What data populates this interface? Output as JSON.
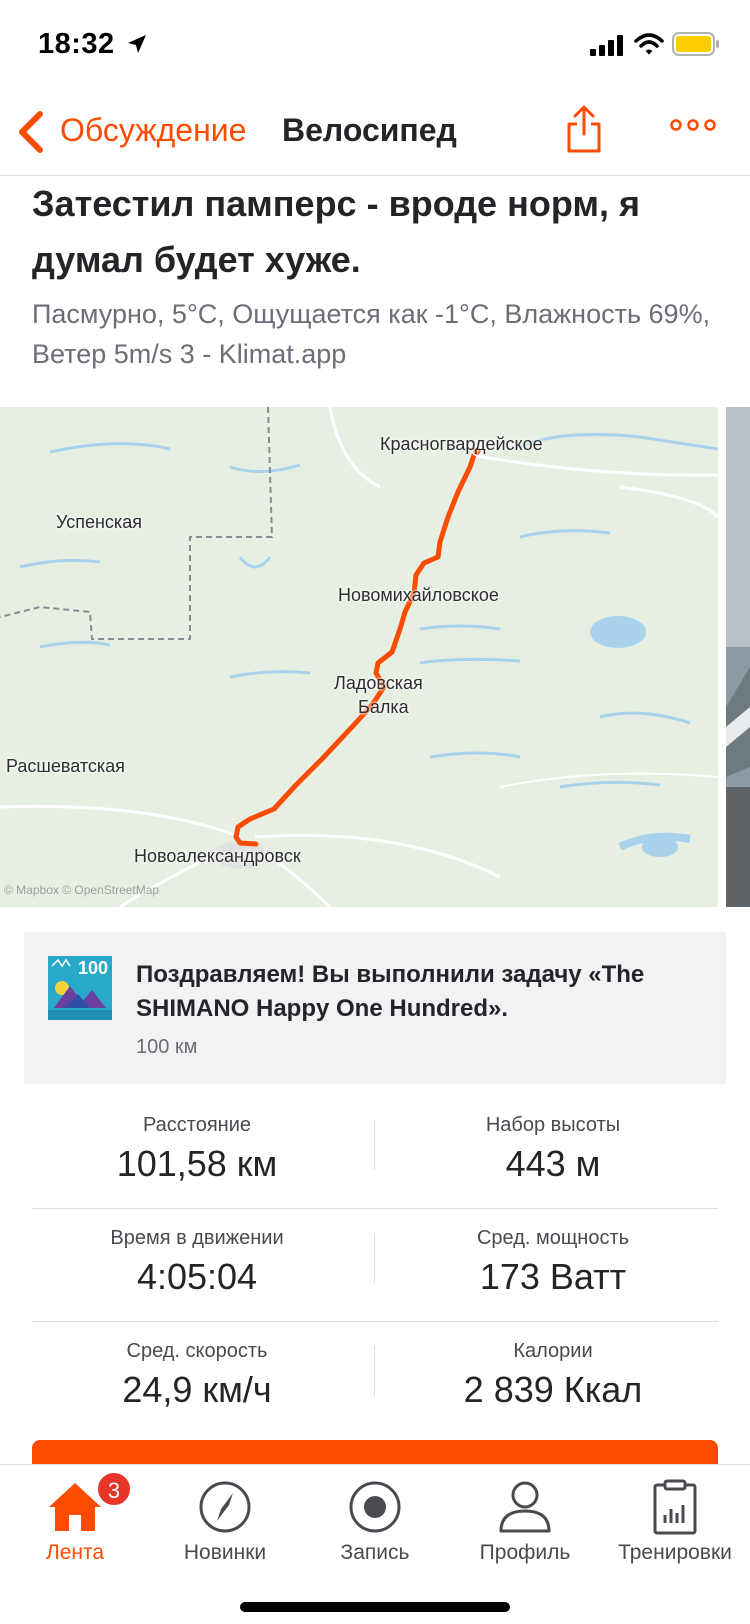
{
  "status_bar": {
    "time": "18:32",
    "battery_color": "#ffcc00"
  },
  "nav": {
    "back_label": "Обсуждение",
    "title": "Велосипед",
    "accent_color": "#fc4c02"
  },
  "post": {
    "title": "Затестил памперс - вроде норм, я думал будет хуже.",
    "description": "Пасмурно, 5°C, Ощущается как -1°C, Влажность 69%, Ветер 5m/s  3 - Klimat.app"
  },
  "map": {
    "labels": [
      "Красногвардейское",
      "Успенская",
      "Новомихайловское",
      "Ладовская",
      "Балка",
      "Расшеватская",
      "Новоалександровск"
    ],
    "attribution": "© Mapbox © OpenStreetMap",
    "route_color": "#fc4c02"
  },
  "achievement": {
    "badge_text": "100",
    "text": "Поздравляем! Вы выполнили задачу «The SHIMANO Happy One Hundred».",
    "sub": "100 км"
  },
  "stats": [
    {
      "label": "Расстояние",
      "value": "101,58 км"
    },
    {
      "label": "Набор высоты",
      "value": "443 м"
    },
    {
      "label": "Время в движении",
      "value": "4:05:04"
    },
    {
      "label": "Сред. мощность",
      "value": "173 Ватт"
    },
    {
      "label": "Сред. скорость",
      "value": "24,9 км/ч"
    },
    {
      "label": "Калории",
      "value": "2 839 Ккал"
    }
  ],
  "tabs": [
    {
      "label": "Лента",
      "icon": "home-icon",
      "badge": "3",
      "active": true
    },
    {
      "label": "Новинки",
      "icon": "compass-icon"
    },
    {
      "label": "Запись",
      "icon": "record-icon"
    },
    {
      "label": "Профиль",
      "icon": "profile-icon"
    },
    {
      "label": "Тренировки",
      "icon": "training-plan-icon"
    }
  ]
}
